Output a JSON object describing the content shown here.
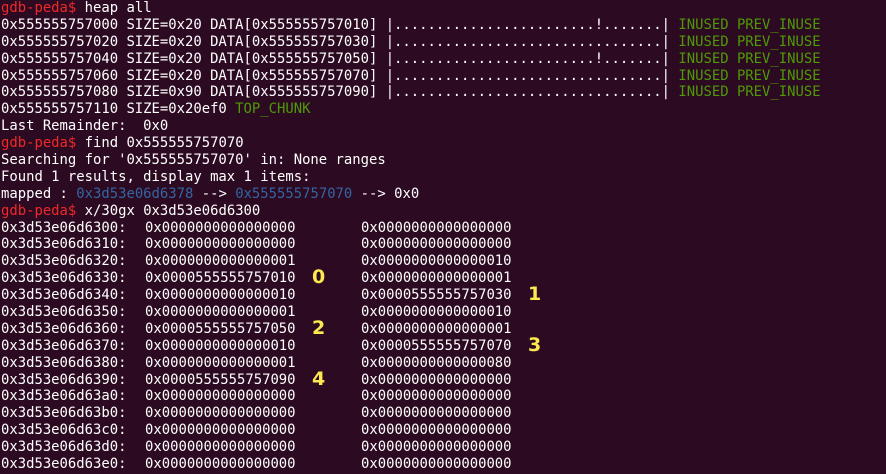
{
  "colors": {
    "background": "#2c0a21",
    "text": "#ffffff",
    "prompt": "#ef2929",
    "flags": "#4e9a06",
    "pointer": "#3465a4",
    "marker": "#fce94f"
  },
  "prompt": "gdb-peda$",
  "commands": {
    "heap": "heap all",
    "find": "find 0x555555757070",
    "examine": "x/30gx 0x3d53e06d6300"
  },
  "heap_chunks": [
    {
      "text": "0x555555757000 SIZE=0x20 DATA[0x555555757010] |........................!.......|",
      "flags": "INUSED PREV_INUSE"
    },
    {
      "text": "0x555555757020 SIZE=0x20 DATA[0x555555757030] |................................|",
      "flags": "INUSED PREV_INUSE"
    },
    {
      "text": "0x555555757040 SIZE=0x20 DATA[0x555555757050] |........................!.......|",
      "flags": "INUSED PREV_INUSE"
    },
    {
      "text": "0x555555757060 SIZE=0x20 DATA[0x555555757070] |................................|",
      "flags": "INUSED PREV_INUSE"
    },
    {
      "text": "0x555555757080 SIZE=0x90 DATA[0x555555757090] |................................|",
      "flags": "INUSED PREV_INUSE"
    }
  ],
  "top_chunk": {
    "text": "0x555555757110 SIZE=0x20ef0 ",
    "flag": "TOP_CHUNK"
  },
  "last_remainder": "Last Remainder:  0x0",
  "search": {
    "searching": "Searching for '0x555555757070' in: None ranges",
    "found": "Found 1 results, display max 1 items:",
    "mapped_label": "mapped : ",
    "mapped_addr": "0x3d53e06d6378",
    "arrow1": " --> ",
    "target": "0x555555757070",
    "arrow2": " --> 0x0"
  },
  "memory": [
    {
      "addr": "0x3d53e06d6300:",
      "v1": "0x0000000000000000",
      "v2": "0x0000000000000000",
      "m1": "",
      "m2": ""
    },
    {
      "addr": "0x3d53e06d6310:",
      "v1": "0x0000000000000000",
      "v2": "0x0000000000000000",
      "m1": "",
      "m2": ""
    },
    {
      "addr": "0x3d53e06d6320:",
      "v1": "0x0000000000000001",
      "v2": "0x0000000000000010",
      "m1": "",
      "m2": ""
    },
    {
      "addr": "0x3d53e06d6330:",
      "v1": "0x0000555555757010",
      "v2": "0x0000000000000001",
      "m1": "0",
      "m2": ""
    },
    {
      "addr": "0x3d53e06d6340:",
      "v1": "0x0000000000000010",
      "v2": "0x0000555555757030",
      "m1": "",
      "m2": "1"
    },
    {
      "addr": "0x3d53e06d6350:",
      "v1": "0x0000000000000001",
      "v2": "0x0000000000000010",
      "m1": "",
      "m2": ""
    },
    {
      "addr": "0x3d53e06d6360:",
      "v1": "0x0000555555757050",
      "v2": "0x0000000000000001",
      "m1": "2",
      "m2": ""
    },
    {
      "addr": "0x3d53e06d6370:",
      "v1": "0x0000000000000010",
      "v2": "0x0000555555757070",
      "m1": "",
      "m2": "3"
    },
    {
      "addr": "0x3d53e06d6380:",
      "v1": "0x0000000000000001",
      "v2": "0x0000000000000080",
      "m1": "",
      "m2": ""
    },
    {
      "addr": "0x3d53e06d6390:",
      "v1": "0x0000555555757090",
      "v2": "0x0000000000000000",
      "m1": "4",
      "m2": ""
    },
    {
      "addr": "0x3d53e06d63a0:",
      "v1": "0x0000000000000000",
      "v2": "0x0000000000000000",
      "m1": "",
      "m2": ""
    },
    {
      "addr": "0x3d53e06d63b0:",
      "v1": "0x0000000000000000",
      "v2": "0x0000000000000000",
      "m1": "",
      "m2": ""
    },
    {
      "addr": "0x3d53e06d63c0:",
      "v1": "0x0000000000000000",
      "v2": "0x0000000000000000",
      "m1": "",
      "m2": ""
    },
    {
      "addr": "0x3d53e06d63d0:",
      "v1": "0x0000000000000000",
      "v2": "0x0000000000000000",
      "m1": "",
      "m2": ""
    },
    {
      "addr": "0x3d53e06d63e0:",
      "v1": "0x0000000000000000",
      "v2": "0x0000000000000000",
      "m1": "",
      "m2": ""
    }
  ]
}
